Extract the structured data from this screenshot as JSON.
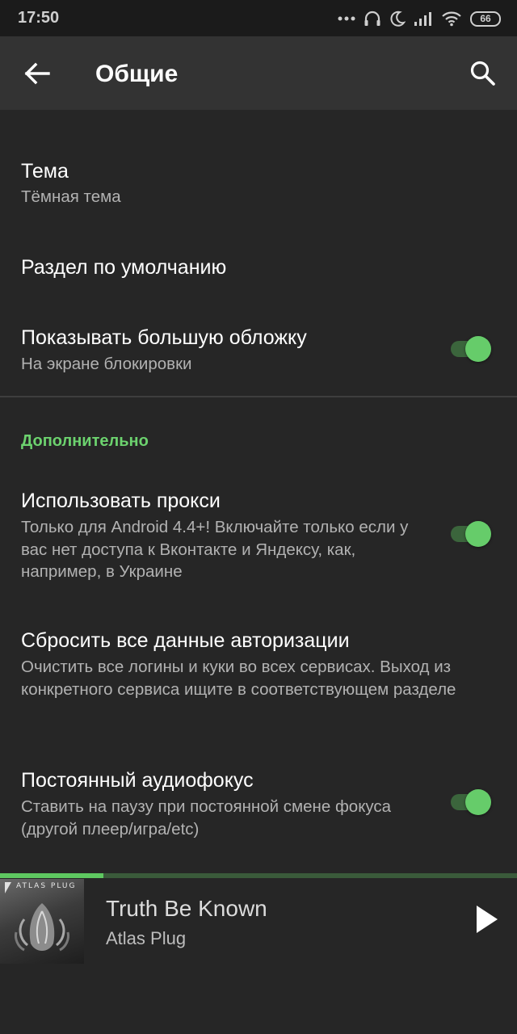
{
  "status_bar": {
    "time": "17:50",
    "battery": "66",
    "icons": [
      "more-dots-icon",
      "headphones-icon",
      "moon-icon",
      "signal-icon",
      "wifi-icon",
      "battery-icon"
    ]
  },
  "app_bar": {
    "title": "Общие",
    "back_icon": "arrow-left-icon",
    "search_icon": "search-icon"
  },
  "preferences": {
    "theme": {
      "title": "Тема",
      "summary": "Тёмная тема"
    },
    "default_section": {
      "title": "Раздел по умолчанию"
    },
    "big_cover": {
      "title": "Показывать большую обложку",
      "summary": "На экране блокировки",
      "enabled": true
    }
  },
  "additional": {
    "header": "Дополнительно",
    "proxy": {
      "title": "Использовать прокси",
      "summary": "Только для Android 4.4+! Включайте только если у вас нет доступа к Вконтакте и Яндексу, как, например, в Украине",
      "enabled": true
    },
    "reset_auth": {
      "title": "Сбросить все данные авторизации",
      "summary": "Очистить все логины и куки во всех сервисах. Выход из конкретного сервиса ищите в соответствующем разделе"
    },
    "audio_focus": {
      "title": "Постоянный аудиофокус",
      "summary": "Ставить на паузу при постоянной смене фокуса (другой плеер/игра/etc)",
      "enabled": true
    }
  },
  "player": {
    "track_title": "Truth Be Known",
    "artist": "Atlas Plug",
    "album_art_text": "ATLAS PLUG",
    "progress": 0.2,
    "play_icon": "play-icon"
  },
  "colors": {
    "accent": "#66cc6a",
    "background": "#262626",
    "app_bar": "#333333"
  }
}
